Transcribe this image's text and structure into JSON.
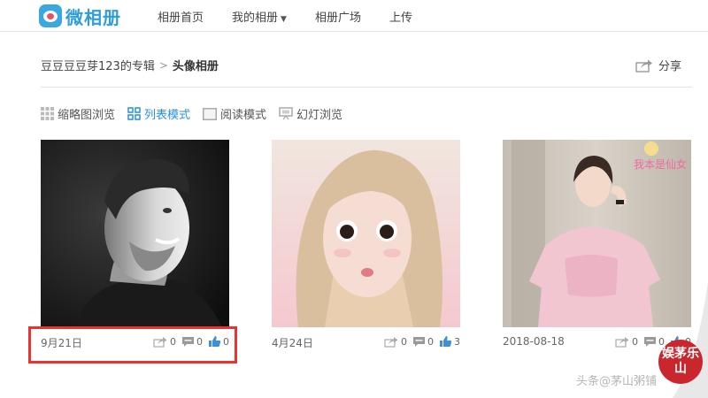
{
  "brand": {
    "name": "微相册"
  },
  "nav": [
    {
      "label": "相册首页"
    },
    {
      "label": "我的相册",
      "dropdown": true
    },
    {
      "label": "相册广场"
    },
    {
      "label": "上传"
    }
  ],
  "breadcrumb": {
    "parent": "豆豆豆豆芽123的专辑",
    "separator": ">",
    "current": "头像相册"
  },
  "share_label": "分享",
  "view_modes": [
    {
      "label": "缩略图浏览",
      "icon": "grid-icon",
      "active": false
    },
    {
      "label": "列表模式",
      "icon": "list-grid-icon",
      "active": true
    },
    {
      "label": "阅读模式",
      "icon": "reading-icon",
      "active": false
    },
    {
      "label": "幻灯浏览",
      "icon": "slideshow-icon",
      "active": false
    }
  ],
  "photos": [
    {
      "date": "9月21日",
      "shares": "0",
      "comments": "0",
      "likes": "0"
    },
    {
      "date": "4月24日",
      "shares": "0",
      "comments": "0",
      "likes": "3"
    },
    {
      "date": "2018-08-18",
      "shares": "0",
      "comments": "0",
      "likes": "0"
    }
  ],
  "sticker_text": "我本是仙女",
  "watermark": {
    "text": "头条@茅山粥铺",
    "seal": "娱茅乐山"
  },
  "colors": {
    "accent": "#2b8fd6",
    "highlight": "#e8332f",
    "seal": "#c9272d"
  }
}
